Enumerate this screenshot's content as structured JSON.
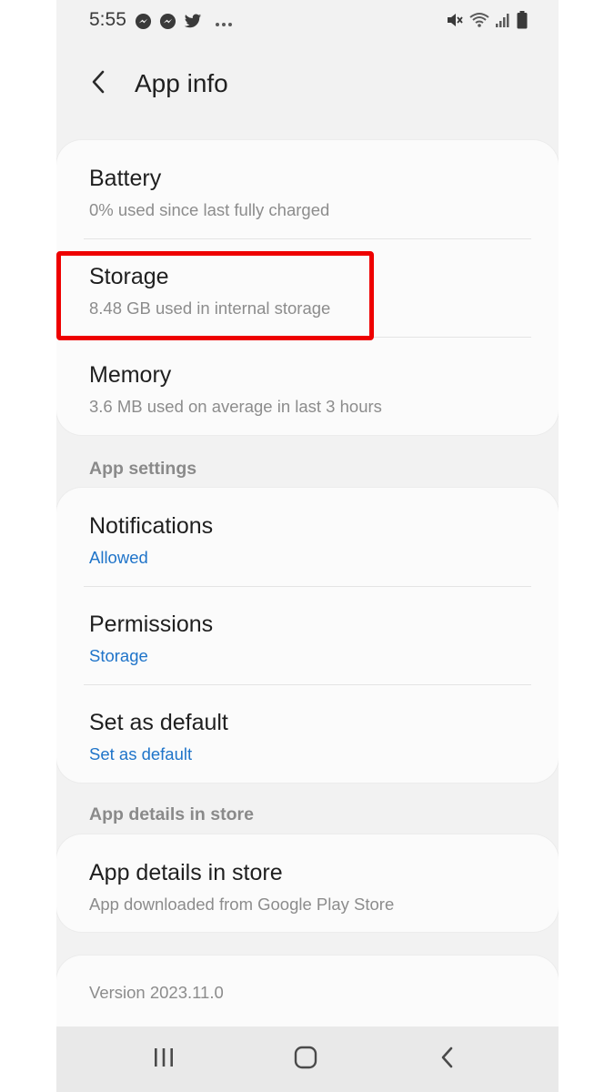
{
  "status_bar": {
    "time": "5:55",
    "left_icons": [
      "messenger-icon",
      "messenger-icon",
      "twitter-icon",
      "more-notifications-icon"
    ],
    "right_icons": [
      "mute-icon",
      "wifi-icon",
      "signal-icon",
      "battery-icon"
    ]
  },
  "header": {
    "title": "App info"
  },
  "usage_card": {
    "items": [
      {
        "title": "Battery",
        "subtitle": "0% used since last fully charged"
      },
      {
        "title": "Storage",
        "subtitle": "8.48 GB used in internal storage"
      },
      {
        "title": "Memory",
        "subtitle": "3.6 MB used on average in last 3 hours"
      }
    ]
  },
  "app_settings": {
    "header": "App settings",
    "items": [
      {
        "title": "Notifications",
        "subtitle": "Allowed"
      },
      {
        "title": "Permissions",
        "subtitle": "Storage"
      },
      {
        "title": "Set as default",
        "subtitle": "Set as default"
      }
    ]
  },
  "store": {
    "header": "App details in store",
    "title": "App details in store",
    "subtitle": "App downloaded from Google Play Store"
  },
  "version": {
    "text": "Version 2023.11.0"
  },
  "nav_bar": {
    "buttons": [
      "recent-apps-icon",
      "home-icon",
      "back-icon"
    ]
  },
  "colors": {
    "highlight": "#ee0000",
    "link_blue": "#1f74c9",
    "background": "#f2f2f2"
  }
}
